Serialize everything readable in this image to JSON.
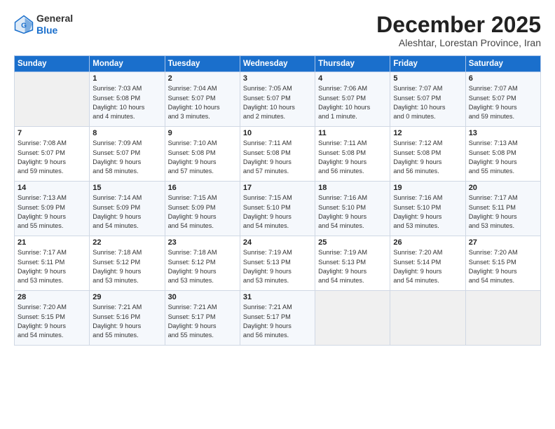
{
  "logo": {
    "line1": "General",
    "line2": "Blue"
  },
  "title": "December 2025",
  "subtitle": "Aleshtar, Lorestan Province, Iran",
  "days_header": [
    "Sunday",
    "Monday",
    "Tuesday",
    "Wednesday",
    "Thursday",
    "Friday",
    "Saturday"
  ],
  "weeks": [
    [
      {
        "day": "",
        "text": ""
      },
      {
        "day": "1",
        "text": "Sunrise: 7:03 AM\nSunset: 5:08 PM\nDaylight: 10 hours\nand 4 minutes."
      },
      {
        "day": "2",
        "text": "Sunrise: 7:04 AM\nSunset: 5:07 PM\nDaylight: 10 hours\nand 3 minutes."
      },
      {
        "day": "3",
        "text": "Sunrise: 7:05 AM\nSunset: 5:07 PM\nDaylight: 10 hours\nand 2 minutes."
      },
      {
        "day": "4",
        "text": "Sunrise: 7:06 AM\nSunset: 5:07 PM\nDaylight: 10 hours\nand 1 minute."
      },
      {
        "day": "5",
        "text": "Sunrise: 7:07 AM\nSunset: 5:07 PM\nDaylight: 10 hours\nand 0 minutes."
      },
      {
        "day": "6",
        "text": "Sunrise: 7:07 AM\nSunset: 5:07 PM\nDaylight: 9 hours\nand 59 minutes."
      }
    ],
    [
      {
        "day": "7",
        "text": "Sunrise: 7:08 AM\nSunset: 5:07 PM\nDaylight: 9 hours\nand 59 minutes."
      },
      {
        "day": "8",
        "text": "Sunrise: 7:09 AM\nSunset: 5:07 PM\nDaylight: 9 hours\nand 58 minutes."
      },
      {
        "day": "9",
        "text": "Sunrise: 7:10 AM\nSunset: 5:08 PM\nDaylight: 9 hours\nand 57 minutes."
      },
      {
        "day": "10",
        "text": "Sunrise: 7:11 AM\nSunset: 5:08 PM\nDaylight: 9 hours\nand 57 minutes."
      },
      {
        "day": "11",
        "text": "Sunrise: 7:11 AM\nSunset: 5:08 PM\nDaylight: 9 hours\nand 56 minutes."
      },
      {
        "day": "12",
        "text": "Sunrise: 7:12 AM\nSunset: 5:08 PM\nDaylight: 9 hours\nand 56 minutes."
      },
      {
        "day": "13",
        "text": "Sunrise: 7:13 AM\nSunset: 5:08 PM\nDaylight: 9 hours\nand 55 minutes."
      }
    ],
    [
      {
        "day": "14",
        "text": "Sunrise: 7:13 AM\nSunset: 5:09 PM\nDaylight: 9 hours\nand 55 minutes."
      },
      {
        "day": "15",
        "text": "Sunrise: 7:14 AM\nSunset: 5:09 PM\nDaylight: 9 hours\nand 54 minutes."
      },
      {
        "day": "16",
        "text": "Sunrise: 7:15 AM\nSunset: 5:09 PM\nDaylight: 9 hours\nand 54 minutes."
      },
      {
        "day": "17",
        "text": "Sunrise: 7:15 AM\nSunset: 5:10 PM\nDaylight: 9 hours\nand 54 minutes."
      },
      {
        "day": "18",
        "text": "Sunrise: 7:16 AM\nSunset: 5:10 PM\nDaylight: 9 hours\nand 54 minutes."
      },
      {
        "day": "19",
        "text": "Sunrise: 7:16 AM\nSunset: 5:10 PM\nDaylight: 9 hours\nand 53 minutes."
      },
      {
        "day": "20",
        "text": "Sunrise: 7:17 AM\nSunset: 5:11 PM\nDaylight: 9 hours\nand 53 minutes."
      }
    ],
    [
      {
        "day": "21",
        "text": "Sunrise: 7:17 AM\nSunset: 5:11 PM\nDaylight: 9 hours\nand 53 minutes."
      },
      {
        "day": "22",
        "text": "Sunrise: 7:18 AM\nSunset: 5:12 PM\nDaylight: 9 hours\nand 53 minutes."
      },
      {
        "day": "23",
        "text": "Sunrise: 7:18 AM\nSunset: 5:12 PM\nDaylight: 9 hours\nand 53 minutes."
      },
      {
        "day": "24",
        "text": "Sunrise: 7:19 AM\nSunset: 5:13 PM\nDaylight: 9 hours\nand 53 minutes."
      },
      {
        "day": "25",
        "text": "Sunrise: 7:19 AM\nSunset: 5:13 PM\nDaylight: 9 hours\nand 54 minutes."
      },
      {
        "day": "26",
        "text": "Sunrise: 7:20 AM\nSunset: 5:14 PM\nDaylight: 9 hours\nand 54 minutes."
      },
      {
        "day": "27",
        "text": "Sunrise: 7:20 AM\nSunset: 5:15 PM\nDaylight: 9 hours\nand 54 minutes."
      }
    ],
    [
      {
        "day": "28",
        "text": "Sunrise: 7:20 AM\nSunset: 5:15 PM\nDaylight: 9 hours\nand 54 minutes."
      },
      {
        "day": "29",
        "text": "Sunrise: 7:21 AM\nSunset: 5:16 PM\nDaylight: 9 hours\nand 55 minutes."
      },
      {
        "day": "30",
        "text": "Sunrise: 7:21 AM\nSunset: 5:17 PM\nDaylight: 9 hours\nand 55 minutes."
      },
      {
        "day": "31",
        "text": "Sunrise: 7:21 AM\nSunset: 5:17 PM\nDaylight: 9 hours\nand 56 minutes."
      },
      {
        "day": "",
        "text": ""
      },
      {
        "day": "",
        "text": ""
      },
      {
        "day": "",
        "text": ""
      }
    ]
  ]
}
